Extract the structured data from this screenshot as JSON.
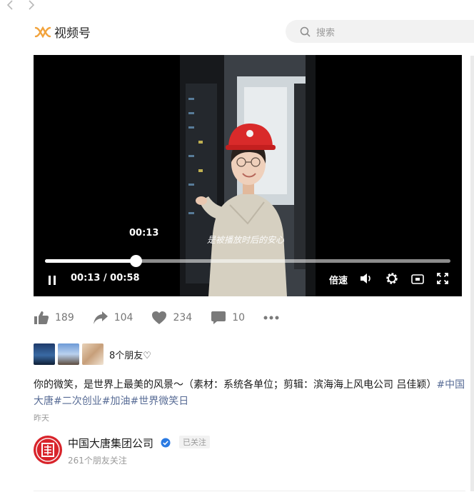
{
  "nav": {
    "back_icon": "chevron-left-icon",
    "forward_icon": "chevron-right-icon"
  },
  "header": {
    "app_name": "视频号",
    "search_placeholder": "搜索",
    "accent": "#f2a33c"
  },
  "player": {
    "hover_time": "00:13",
    "subtitle": "是被播放时后的安心",
    "current_time": "00:13",
    "duration": "00:58",
    "time_display": "00:13 / 00:58",
    "progress_fraction": 0.224,
    "speed_label": "倍速"
  },
  "actions": {
    "likes": "189",
    "shares": "104",
    "hearts": "234",
    "comments": "10"
  },
  "friends": {
    "text": "8个朋友♡"
  },
  "post": {
    "text": "你的微笑，是世界上最美的风景～（素材：系统各单位；剪辑：滨海海上风电公司 吕佳颖）",
    "tags": [
      "#中国大唐",
      "#二次创业",
      "#加油",
      "#世界微笑日"
    ],
    "date": "昨天"
  },
  "author": {
    "name": "中国大唐集团公司",
    "follow_label": "已关注",
    "fans": "261个朋友关注",
    "verified_color": "#2a7ae2"
  }
}
